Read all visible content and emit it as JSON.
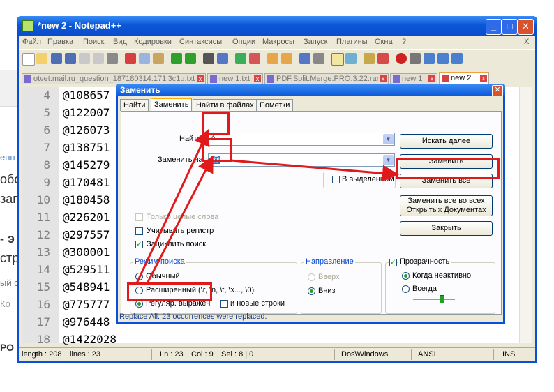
{
  "background": {
    "fragments": [
      "енн",
      "обо",
      "зап",
      "- э",
      "стр",
      "ый с",
      "Ко",
      "РО"
    ]
  },
  "window": {
    "title": "*new 2 - Notepad++",
    "buttons": {
      "minimize": "_",
      "maximize": "□",
      "close": "✕"
    }
  },
  "menu": [
    "Файл",
    "Правка",
    "Поиск",
    "Вид",
    "Кодировки",
    "Синтаксисы",
    "Опции",
    "Макросы",
    "Запуск",
    "Плагины",
    "Окна",
    "?"
  ],
  "menu_close": "X",
  "tabs": [
    {
      "label": "otvet.mail.ru_question_187180314.171l3c1u.txt"
    },
    {
      "label": "new 1.txt"
    },
    {
      "label": "PDF.Split.Merge.PRO.3.22.rar"
    },
    {
      "label": "new 1"
    },
    {
      "label": "new 2",
      "active": true
    }
  ],
  "editor": {
    "lines": [
      {
        "n": "4",
        "code": "@108657"
      },
      {
        "n": "5",
        "code": "@122007"
      },
      {
        "n": "6",
        "code": "@126073"
      },
      {
        "n": "7",
        "code": "@138751"
      },
      {
        "n": "8",
        "code": "@145279"
      },
      {
        "n": "9",
        "code": "@170481"
      },
      {
        "n": "10",
        "code": "@180458"
      },
      {
        "n": "11",
        "code": "@226201"
      },
      {
        "n": "12",
        "code": "@297557"
      },
      {
        "n": "13",
        "code": "@300001"
      },
      {
        "n": "14",
        "code": "@529511"
      },
      {
        "n": "15",
        "code": "@548941"
      },
      {
        "n": "16",
        "code": "@775777"
      },
      {
        "n": "17",
        "code": "@976448"
      },
      {
        "n": "18",
        "code": "@1422028"
      }
    ]
  },
  "statusbar": {
    "length": "length : 208",
    "lines": "lines : 23",
    "ln": "Ln : 23",
    "col": "Col : 9",
    "sel": "Sel : 8 | 0",
    "eol": "Dos\\Windows",
    "encoding": "ANSI",
    "mode": "INS"
  },
  "dialog": {
    "title": "Заменить",
    "close": "✕",
    "tabs": [
      "Найти",
      "Заменить",
      "Найти в файлах",
      "Пометки"
    ],
    "find_label": "Найти :",
    "find_value": "^",
    "replace_label": "Заменить на :",
    "replace_value": "@",
    "buttons": {
      "find_next": "Искать далее",
      "replace": "Заменить",
      "replace_all": "Заменить все",
      "replace_all_docs_1": "Заменить все во всех",
      "replace_all_docs_2": "Открытых Документах",
      "close": "Закрыть"
    },
    "in_selection": "В выделенном",
    "whole_word": "Только целые слова",
    "match_case": "Учитывать регистр",
    "wrap": "Зациклить поиск",
    "search_mode": {
      "title": "Режим поиска",
      "normal": "Обычный",
      "extended": "Расширенный (\\r, \\n, \\t, \\x..., \\0)",
      "regex": "Регуляр. выражен",
      "newline": "и новые строки"
    },
    "direction": {
      "title": "Направление",
      "up": "Вверх",
      "down": "Вниз"
    },
    "transparency": {
      "title": "Прозрачность",
      "inactive": "Когда неактивно",
      "always": "Всегда"
    },
    "status": "Replace All: 23 occurrences were replaced."
  },
  "colors": {
    "xp_blue": "#0a4fd8",
    "annotation_red": "#e01a1a",
    "dialog_bg": "#ece9d8"
  }
}
